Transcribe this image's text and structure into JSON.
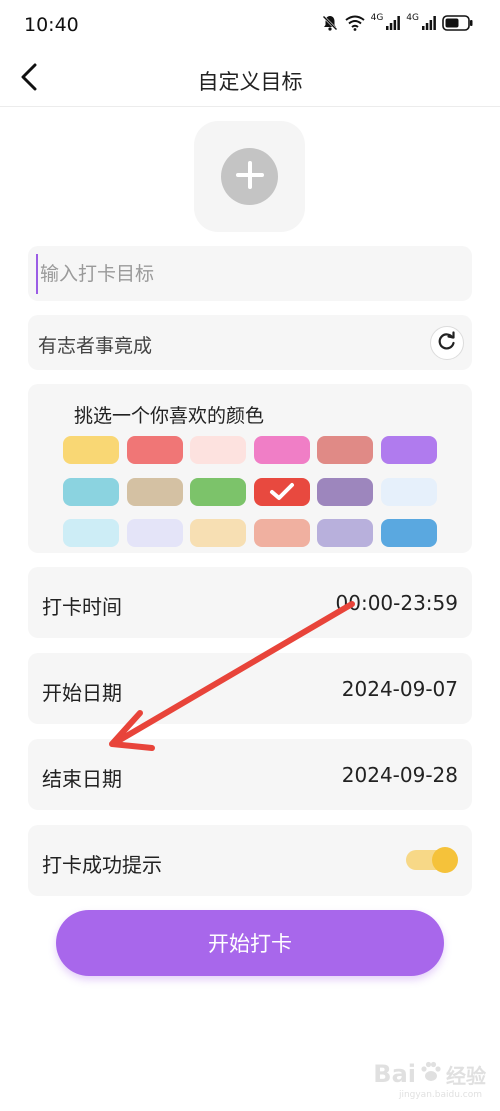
{
  "status_bar": {
    "time": "10:40",
    "network_1": "4G",
    "network_2": "4G"
  },
  "header": {
    "title": "自定义目标"
  },
  "goal_input": {
    "placeholder": "输入打卡目标",
    "value": ""
  },
  "motto": {
    "text": "有志者事竟成"
  },
  "color_picker": {
    "title": "挑选一个你喜欢的颜色",
    "selected_index": 9,
    "colors": [
      "#f9d774",
      "#f07676",
      "#fde2df",
      "#f07ec6",
      "#e08a86",
      "#b07bee",
      "#8bd3e0",
      "#d4c1a3",
      "#7cc36a",
      "#e8493f",
      "#9d86bd",
      "#e6f0fb",
      "#cdedf6",
      "#e4e4f8",
      "#f7dfb3",
      "#f0b0a0",
      "#b8b0dc",
      "#5aa8e0"
    ]
  },
  "settings": {
    "checkin_time_label": "打卡时间",
    "checkin_time_value": "00:00-23:59",
    "start_date_label": "开始日期",
    "start_date_value": "2024-09-07",
    "end_date_label": "结束日期",
    "end_date_value": "2024-09-28",
    "notify_label": "打卡成功提示",
    "notify_enabled": true
  },
  "start_button": {
    "label": "开始打卡"
  },
  "watermark": {
    "brand": "Bai",
    "text": "经验",
    "sub": "jingyan.baidu.com"
  },
  "colors": {
    "accent": "#a867eb",
    "card_bg": "#f6f6f6",
    "toggle_on": "#f5c23a",
    "annotation": "#e8443a"
  }
}
